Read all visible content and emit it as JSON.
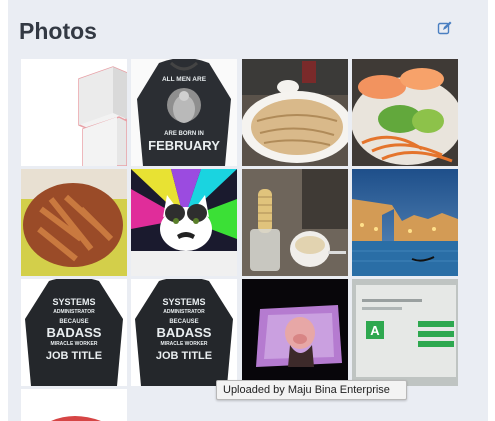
{
  "header": {
    "title": "Photos",
    "edit_icon": "pencil-square-icon"
  },
  "tiles": {
    "shirt_february": {
      "text_top": "ALL MEN ARE",
      "text_mid": "ARE BORN IN",
      "text_main": "FEBRUARY"
    },
    "shirt_sysadmin": {
      "lines": [
        "SYSTEMS",
        "ADMINISTRATOR",
        "BECAUSE",
        "BADASS",
        "MIRACLE WORKER",
        "JOB TITLE"
      ]
    },
    "screen_letter": "A"
  },
  "tooltip": {
    "text": "Uploaded by Maju Bina Enterprise"
  },
  "colors": {
    "panel_bg": "#eaedf3",
    "title": "#333943",
    "accent": "#4a7fc1",
    "tooltip_bg": "#f3f3f3"
  }
}
